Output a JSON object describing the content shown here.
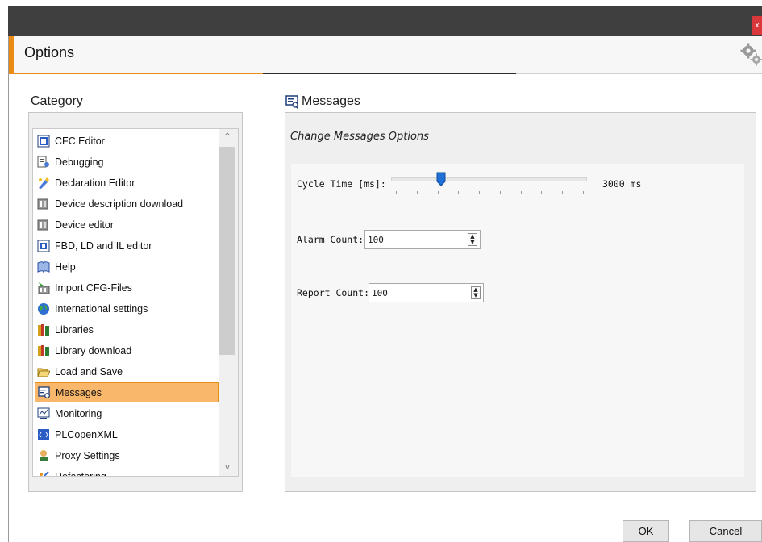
{
  "window": {
    "close_glyph": "x",
    "title": "Options",
    "accent_color": "#e98b14",
    "header_icon": "gears-icon"
  },
  "category": {
    "title": "Category",
    "items": [
      {
        "label": "CFC Editor",
        "icon": "cfc-editor-icon"
      },
      {
        "label": "Debugging",
        "icon": "debugging-icon"
      },
      {
        "label": "Declaration Editor",
        "icon": "declaration-editor-icon"
      },
      {
        "label": "Device description download",
        "icon": "device-description-icon"
      },
      {
        "label": "Device editor",
        "icon": "device-editor-icon"
      },
      {
        "label": "FBD, LD and IL editor",
        "icon": "fbd-editor-icon"
      },
      {
        "label": "Help",
        "icon": "help-icon"
      },
      {
        "label": "Import CFG-Files",
        "icon": "import-cfg-icon"
      },
      {
        "label": "International settings",
        "icon": "globe-icon"
      },
      {
        "label": "Libraries",
        "icon": "libraries-icon"
      },
      {
        "label": "Library download",
        "icon": "library-download-icon"
      },
      {
        "label": "Load and Save",
        "icon": "folder-open-icon"
      },
      {
        "label": "Messages",
        "icon": "messages-icon",
        "selected": true
      },
      {
        "label": "Monitoring",
        "icon": "monitoring-icon"
      },
      {
        "label": "PLCopenXML",
        "icon": "plcopenxml-icon"
      },
      {
        "label": "Proxy Settings",
        "icon": "proxy-icon"
      },
      {
        "label": "Refactoring",
        "icon": "refactoring-icon"
      }
    ],
    "selected_color": "#f8b76a"
  },
  "messages": {
    "title": "Messages",
    "subtitle": "Change Messages Options",
    "cycle_label": "Cycle Time [ms]:",
    "cycle_value": "3000 ms",
    "cycle_slider_fraction": 0.24,
    "alarm_label": "Alarm Count:",
    "alarm_value": "100",
    "report_label": "Report Count:",
    "report_value": "100"
  },
  "footer": {
    "ok_label": "OK",
    "cancel_label": "Cancel"
  }
}
